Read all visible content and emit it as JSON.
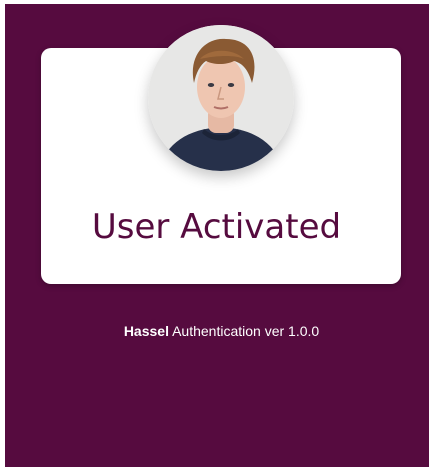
{
  "card": {
    "title": "User Activated"
  },
  "avatar": {
    "icon": "user-photo"
  },
  "footer": {
    "brand": "Hassel",
    "text": " Authentication ver 1.0.0"
  },
  "colors": {
    "background": "#560b3f",
    "card": "#ffffff",
    "title": "#560b3f",
    "footer_text": "#ffffff"
  }
}
